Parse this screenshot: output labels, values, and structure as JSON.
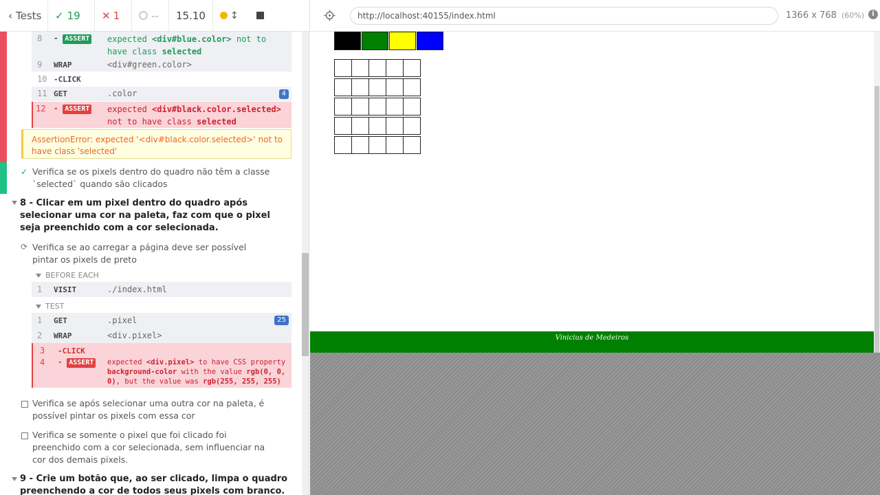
{
  "header": {
    "tests_label": "Tests",
    "passed": "19",
    "failed": "1",
    "pending": "--",
    "duration": "15.10"
  },
  "urlbar": {
    "url": "http://localhost:40155/index.html",
    "viewport": "1366 x 768",
    "zoom": "(60%)"
  },
  "commands_top": [
    {
      "num": "8",
      "name": "ASSERT",
      "line1_pre": "expected ",
      "line1_el": "<div#blue.color>",
      "line1_post": " not to",
      "line2_pre": "have class ",
      "line2_val": "selected"
    },
    {
      "num": "9",
      "name": "WRAP",
      "msg": "<div#green.color>"
    },
    {
      "num": "10",
      "name": "-CLICK"
    },
    {
      "num": "11",
      "name": "GET",
      "msg": ".color",
      "badge": "4"
    },
    {
      "num": "12",
      "name": "ASSERT",
      "line1_pre": "expected ",
      "line1_el": "<div#black.color.selected>",
      "line2_pre": "not to have class ",
      "line2_val": "selected"
    }
  ],
  "error_message": "AssertionError: expected '<div#black.color.selected>' not to have class 'selected'",
  "tests": {
    "passed_test": "Verifica se os pixels dentro do quadro não têm a classe `selected` quando são clicados",
    "suite8": "8 - Clicar em um pixel dentro do quadro após selecionar uma cor na paleta, faz com que o pixel seja preenchido com a cor selecionada.",
    "running_test": "Verifica se ao carregar a página deve ser possível pintar os pixels de preto",
    "before_each": "BEFORE EACH",
    "test_label": "TEST",
    "pending_test_1": "Verifica se após selecionar uma outra cor na paleta, é possível pintar os pixels com essa cor",
    "pending_test_2": "Verifica se somente o pixel que foi clicado foi preenchido com a cor selecionada, sem influenciar na cor dos demais pixels.",
    "suite9": "9 - Crie um botão que, ao ser clicado, limpa o quadro preenchendo a cor de todos seus pixels com branco."
  },
  "commands_bottom": [
    {
      "num": "1",
      "name": "VISIT",
      "msg": "./index.html"
    },
    {
      "num": "1",
      "name": "GET",
      "msg": ".pixel",
      "badge": "25"
    },
    {
      "num": "2",
      "name": "WRAP",
      "msg": "<div.pixel>"
    },
    {
      "num": "3",
      "name": "-CLICK"
    },
    {
      "num": "4",
      "name": "ASSERT",
      "l1a": "expected ",
      "l1b": "<div.pixel>",
      "l1c": " to have CSS property",
      "l2a": "background-color",
      "l2b": " with the value ",
      "l2c": "rgb(0, 0,",
      "l3a": "0)",
      "l3b": ", but the value was ",
      "l3c": "rgb(255, 255, 255)"
    }
  ],
  "app": {
    "palette": [
      "#000000",
      "#008000",
      "#ffff00",
      "#0000ff"
    ],
    "footer_text": "Vinicius de Medeiros"
  }
}
